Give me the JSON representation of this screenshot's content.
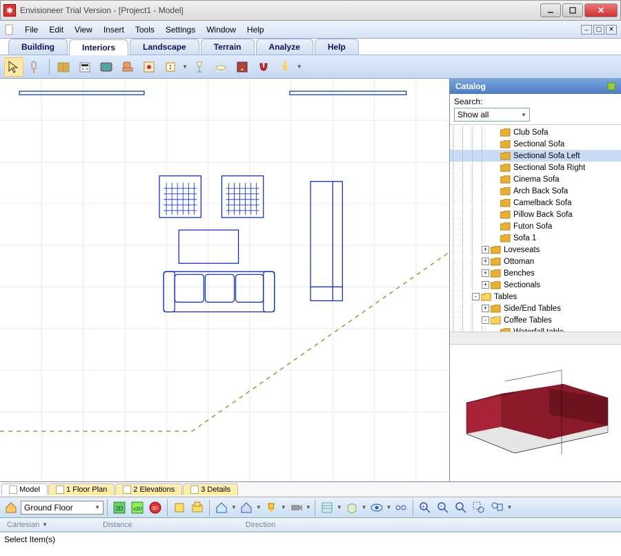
{
  "window": {
    "title": "Envisioneer Trial Version - [Project1 - Model]"
  },
  "menu": {
    "items": [
      "File",
      "Edit",
      "View",
      "Insert",
      "Tools",
      "Settings",
      "Window",
      "Help"
    ]
  },
  "tabs": {
    "items": [
      "Building",
      "Interiors",
      "Landscape",
      "Terrain",
      "Analyze",
      "Help"
    ],
    "active": 1
  },
  "toolbar": {
    "icons": [
      "arrow",
      "brush",
      "cabinet",
      "stove",
      "tv",
      "chair",
      "picture",
      "outlet",
      "lamp",
      "ceiling-light",
      "fireplace",
      "magnet",
      "person"
    ]
  },
  "catalog": {
    "title": "Catalog",
    "search_label": "Search:",
    "dropdown": "Show all",
    "tree": [
      {
        "indent": 4,
        "exp": null,
        "type": "item",
        "label": "Club Sofa"
      },
      {
        "indent": 4,
        "exp": null,
        "type": "item",
        "label": "Sectional Sofa"
      },
      {
        "indent": 4,
        "exp": null,
        "type": "item",
        "label": "Sectional Sofa Left",
        "selected": true
      },
      {
        "indent": 4,
        "exp": null,
        "type": "item",
        "label": "Sectional Sofa Right"
      },
      {
        "indent": 4,
        "exp": null,
        "type": "item",
        "label": "Cinema Sofa"
      },
      {
        "indent": 4,
        "exp": null,
        "type": "item",
        "label": "Arch Back Sofa"
      },
      {
        "indent": 4,
        "exp": null,
        "type": "item",
        "label": "Camelback Sofa"
      },
      {
        "indent": 4,
        "exp": null,
        "type": "item",
        "label": "Pillow Back Sofa"
      },
      {
        "indent": 4,
        "exp": null,
        "type": "item",
        "label": "Futon Sofa"
      },
      {
        "indent": 4,
        "exp": null,
        "type": "item",
        "label": "Sofa 1"
      },
      {
        "indent": 3,
        "exp": "+",
        "type": "folder",
        "label": "Loveseats"
      },
      {
        "indent": 3,
        "exp": "+",
        "type": "folder",
        "label": "Ottoman"
      },
      {
        "indent": 3,
        "exp": "+",
        "type": "folder",
        "label": "Benches"
      },
      {
        "indent": 3,
        "exp": "+",
        "type": "folder",
        "label": "Sectionals"
      },
      {
        "indent": 2,
        "exp": "-",
        "type": "folder-open",
        "label": "Tables"
      },
      {
        "indent": 3,
        "exp": "+",
        "type": "folder",
        "label": "Side/End Tables"
      },
      {
        "indent": 3,
        "exp": "-",
        "type": "folder-open",
        "label": "Coffee Tables"
      },
      {
        "indent": 4,
        "exp": null,
        "type": "item",
        "label": "Waterfall table"
      }
    ]
  },
  "doc_tabs": {
    "items": [
      "Model",
      "1 Floor Plan",
      "2 Elevations",
      "3 Details"
    ],
    "active": 0
  },
  "lower": {
    "floor": "Ground Floor"
  },
  "readout": {
    "r1": "Cartesian",
    "r2": "Distance",
    "r3": "Direction"
  },
  "status": {
    "text": "Select Item(s)"
  }
}
